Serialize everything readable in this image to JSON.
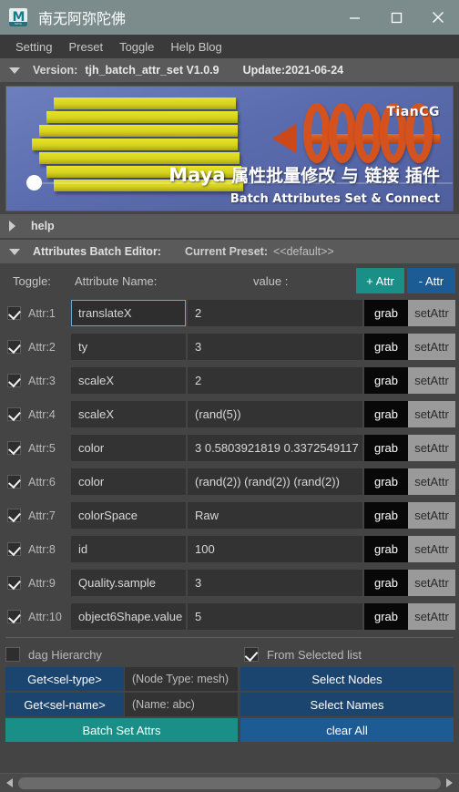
{
  "window": {
    "title": "南无阿弥陀佛",
    "icon": "maya-logo-icon",
    "minimize": "−",
    "maximize": "□",
    "close": "✕"
  },
  "menubar": {
    "items": [
      {
        "label": "Setting"
      },
      {
        "label": "Preset"
      },
      {
        "label": "Toggle"
      },
      {
        "label": "Help Blog"
      }
    ]
  },
  "version_bar": {
    "expander": "triangle-down-icon",
    "label": "Version:",
    "value": "tjh_batch_attr_set V1.0.9",
    "update": "Update:2021-06-24"
  },
  "banner": {
    "title_cn": "属性批量修改 与 链接 插件",
    "title_app": "Maya",
    "subtitle": "Batch Attributes Set & Connect",
    "logo": "TianCG"
  },
  "sections": {
    "help": {
      "expander": "triangle-right-icon",
      "label": "help"
    },
    "editor": {
      "expander": "triangle-down-icon",
      "label": "Attributes Batch Editor:",
      "preset_label": "Current Preset:",
      "preset_value": "<<default>>"
    }
  },
  "table": {
    "headers": {
      "toggle": "Toggle:",
      "name": "Attribute Name:",
      "value": "value :"
    },
    "add_attr": "+ Attr",
    "sub_attr": "- Attr",
    "grab_label": "grab",
    "setattr_label": "setAttr",
    "rows": [
      {
        "label": "Attr:1",
        "checked": true,
        "name": "translateX",
        "value": "2",
        "focused": true
      },
      {
        "label": "Attr:2",
        "checked": true,
        "name": "ty",
        "value": "3",
        "focused": false
      },
      {
        "label": "Attr:3",
        "checked": true,
        "name": "scaleX",
        "value": "2",
        "focused": false
      },
      {
        "label": "Attr:4",
        "checked": true,
        "name": "scaleX",
        "value": "(rand(5))",
        "focused": false
      },
      {
        "label": "Attr:5",
        "checked": true,
        "name": "color",
        "value": "3  0.5803921819  0.3372549117",
        "focused": false
      },
      {
        "label": "Attr:6",
        "checked": true,
        "name": "color",
        "value": "(rand(2)) (rand(2)) (rand(2))",
        "focused": false
      },
      {
        "label": "Attr:7",
        "checked": true,
        "name": "colorSpace",
        "value": "Raw",
        "focused": false
      },
      {
        "label": "Attr:8",
        "checked": true,
        "name": "id",
        "value": "100",
        "focused": false
      },
      {
        "label": "Attr:9",
        "checked": true,
        "name": "Quality.sample",
        "value": "3",
        "focused": false
      },
      {
        "label": "Attr:10",
        "checked": true,
        "name": "object6Shape.value",
        "value": "5",
        "focused": false
      }
    ]
  },
  "bottom": {
    "dag_hierarchy": {
      "label": "dag  Hierarchy",
      "checked": false
    },
    "from_selected": {
      "label": "From Selected list",
      "checked": true
    },
    "get_sel_type": "Get<sel-type>",
    "node_type_hint": "(Node Type: mesh)",
    "select_nodes": "Select Nodes",
    "get_sel_name": "Get<sel-name>",
    "name_hint": "(Name: abc)",
    "select_names": "Select Names",
    "batch_set_attrs": "Batch Set Attrs",
    "clear_all": "clear All"
  },
  "colors": {
    "titlebar": "#7c8c8c",
    "accent_teal": "#1a8f87",
    "accent_blue": "#1d5b95",
    "button_navy": "#1b456e",
    "panel_bg": "#444444",
    "field_bg": "#333333",
    "focus_border": "#6aa6d0"
  }
}
